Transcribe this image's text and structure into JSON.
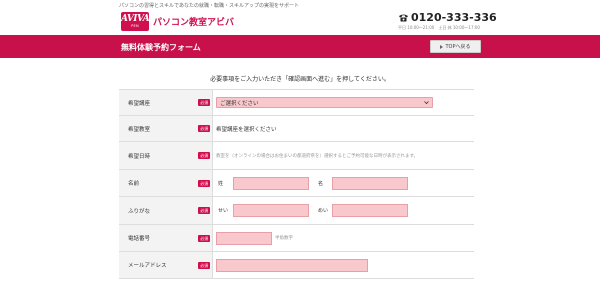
{
  "header": {
    "tagline": "パソコンの習得とスキルであなたの就職・転職・スキルアップの実現をサポート",
    "logo_text": "AVIVA",
    "logo_sub": "PEN",
    "brand_name": "パソコン教室アビバ",
    "phone": "0120-333-336",
    "hours": "平日 10:00〜21:00　土日 休 10:00〜17:00"
  },
  "title_bar": {
    "title": "無料体験予約フォーム",
    "top_button": "TOPへ戻る"
  },
  "instruction": "必要事項をご入力いただき「確認画面へ進む」を押してください。",
  "form": {
    "required_badge": "必須",
    "course": {
      "label": "希望講座",
      "selected": "ご選択ください"
    },
    "classroom": {
      "label": "希望教室",
      "value": "希望講座を選択ください"
    },
    "datetime": {
      "label": "希望日時",
      "note": "教室を（オンラインの場合はお住まいの都道府県を）選択するとご予約可能な日時が表示されます。"
    },
    "name": {
      "label": "名前",
      "last_label": "姓",
      "first_label": "名"
    },
    "kana": {
      "label": "ふりがな",
      "last_label": "せい",
      "first_label": "めい"
    },
    "phone": {
      "label": "電話番号",
      "hint": "半角数字"
    },
    "email": {
      "label": "メールアドレス"
    }
  },
  "colors": {
    "accent": "#c8104a",
    "input_bg": "#f8c8cc"
  }
}
